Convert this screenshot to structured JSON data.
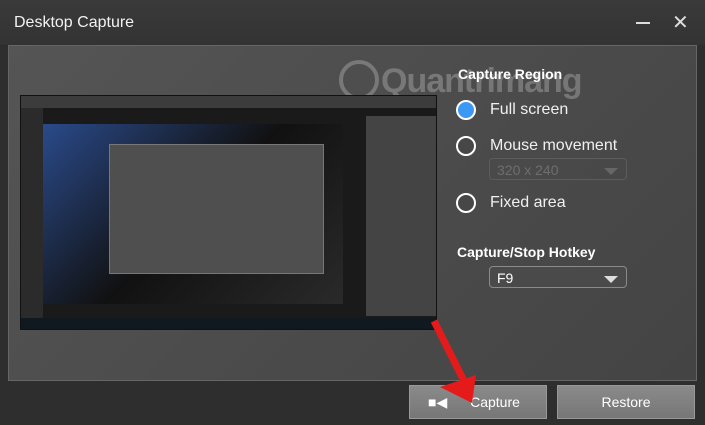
{
  "window": {
    "title": "Desktop Capture"
  },
  "watermark": "Quantrimang",
  "capture_region": {
    "heading": "Capture Region",
    "options": [
      {
        "label": "Full screen",
        "selected": true
      },
      {
        "label": "Mouse movement",
        "selected": false
      },
      {
        "label": "Fixed area",
        "selected": false
      }
    ],
    "mouse_size": "320 x 240"
  },
  "hotkey": {
    "heading": "Capture/Stop Hotkey",
    "value": "F9"
  },
  "buttons": {
    "capture": "Capture",
    "restore": "Restore"
  },
  "colors": {
    "accent": "#3d98f4",
    "annotation_arrow": "#e51b1b"
  }
}
